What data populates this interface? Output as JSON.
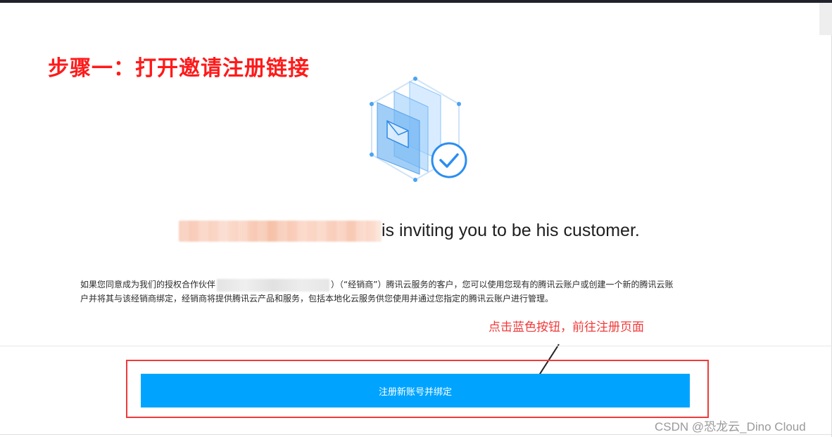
{
  "header": {
    "step_title": "步骤一：打开邀请注册链接"
  },
  "invite": {
    "message": "is inviting you to be his customer."
  },
  "description": {
    "line1_part1": "如果您同意成为我们的授权合作伙伴",
    "line1_part2": "）（“经销商”）腾讯云服务的客户，您可以使用您现有的腾讯云账户或创建一个新的腾讯云账",
    "line2": "户并将其与该经销商绑定，经销商将提供腾讯云产品和服务，包括本地化云服务供您使用并通过您指定的腾讯云账户进行管理。"
  },
  "annotation": {
    "text": "点击蓝色按钮，前往注册页面",
    "color": "#f03a3a"
  },
  "actions": {
    "register_bind_label": "注册新账号并绑定",
    "button_color": "#00a4ff"
  },
  "watermark": {
    "text": "CSDN @恐龙云_Dino Cloud"
  },
  "icons": {
    "illustration": "envelope-check-icon"
  }
}
